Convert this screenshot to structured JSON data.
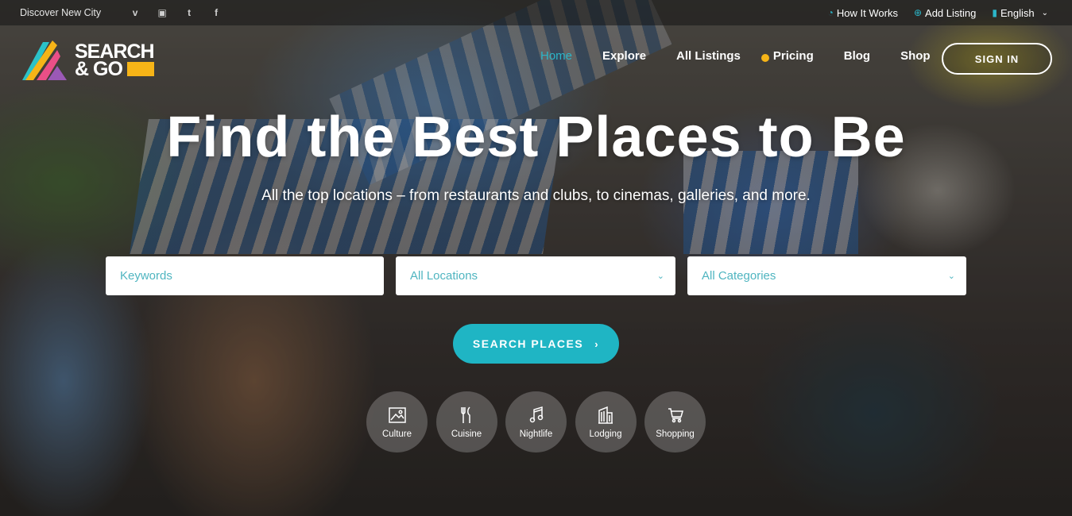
{
  "topbar": {
    "city_label": "Discover New City",
    "social": [
      {
        "icon": "vimeo-icon",
        "glyph": "v"
      },
      {
        "icon": "instagram-icon",
        "glyph": "◙"
      },
      {
        "icon": "twitter-icon",
        "glyph": "🐦"
      },
      {
        "icon": "facebook-icon",
        "glyph": "f"
      }
    ],
    "links": [
      {
        "icon": "pie-chart-icon",
        "label": "How It Works"
      },
      {
        "icon": "plus-circle-icon",
        "label": "Add Listing"
      },
      {
        "icon": "book-icon",
        "label": "English"
      }
    ]
  },
  "brand": {
    "line1": "SEARCH",
    "line2": "& GO",
    "colors": {
      "teal": "#2bc2c8",
      "yellow": "#f6b417",
      "pink": "#ea4f87",
      "purple": "#9b59b6"
    }
  },
  "nav": {
    "items": [
      {
        "label": "Home",
        "active": true
      },
      {
        "label": "Explore"
      },
      {
        "label": "All Listings"
      },
      {
        "label": "Pricing"
      },
      {
        "label": "Blog"
      },
      {
        "label": "Shop"
      }
    ],
    "signin_label": "SIGN IN"
  },
  "hero": {
    "title": "Find the Best Places to Be",
    "subtitle": "All the top locations – from restaurants and clubs, to cinemas, galleries, and more."
  },
  "search": {
    "keywords_placeholder": "Keywords",
    "location_selected": "All Locations",
    "category_selected": "All Categories",
    "button_label": "SEARCH PLACES",
    "button_arrow": "›"
  },
  "categories": [
    {
      "label": "Culture",
      "icon": "picture-icon"
    },
    {
      "label": "Cuisine",
      "icon": "fork-knife-icon"
    },
    {
      "label": "Nightlife",
      "icon": "music-note-icon"
    },
    {
      "label": "Lodging",
      "icon": "building-icon"
    },
    {
      "label": "Shopping",
      "icon": "shopping-cart-icon"
    }
  ],
  "colors": {
    "accent": "#1fb5c4",
    "highlight": "#f6b417"
  }
}
